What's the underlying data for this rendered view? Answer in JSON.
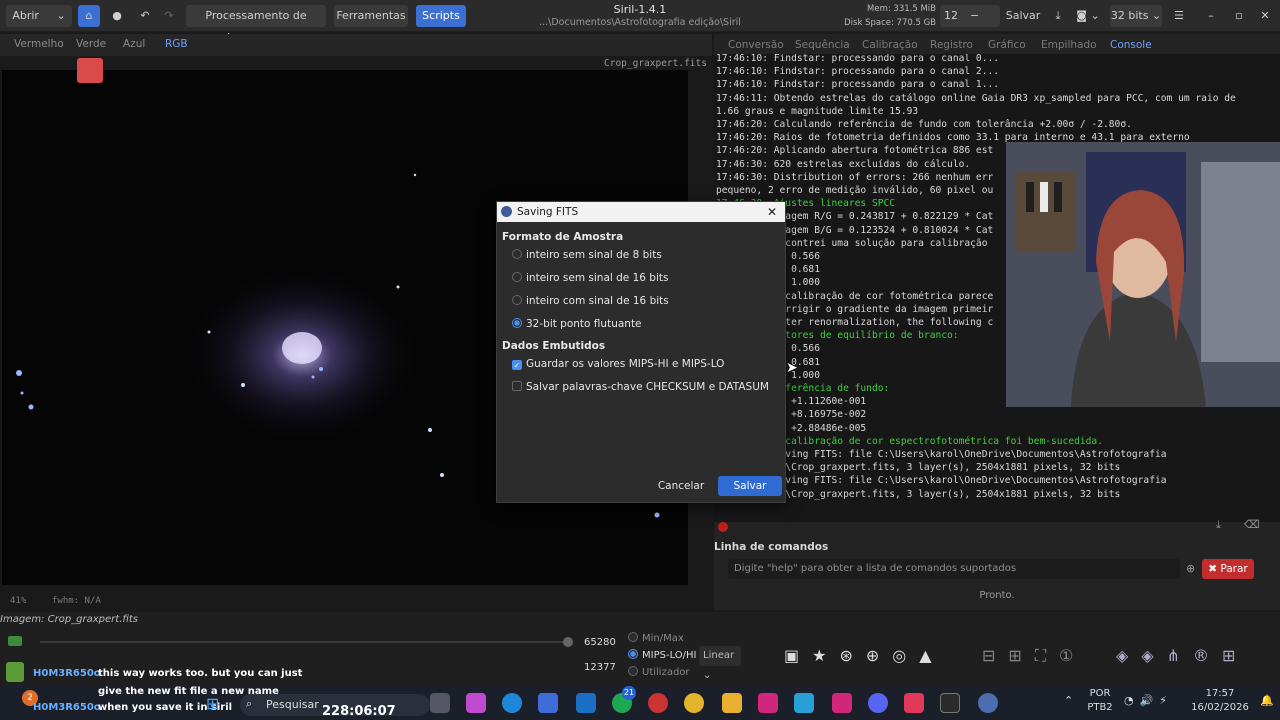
{
  "app": {
    "title": "Siril-1.4.1",
    "path": "...\\Documentos\\Astrofotografia edição\\Siril",
    "mem": "Mem: 331.5 MiB",
    "disk": "Disk Space: 770.5 GB",
    "threads": "12",
    "bitdepth": "32 bits",
    "open_label": "Abrir",
    "img_proc_label": "Processamento de imagem",
    "tools_label": "Ferramentas",
    "scripts_label": "Scripts",
    "save_label": "Salvar"
  },
  "channel_tabs": [
    "Vermelho",
    "Verde",
    "Azul",
    "RGB"
  ],
  "image_filename": "Crop_graxpert.fits",
  "canvas_status": {
    "zoom": "41%",
    "fwhm": "fwhm: N/A"
  },
  "right_tabs": [
    "Conversão",
    "Sequência",
    "Calibração",
    "Registro",
    "Gráfico",
    "Empilhado",
    "Console"
  ],
  "console_lines": [
    "17:46:10: Findstar: processando para o canal 0...",
    "17:46:10: Findstar: processando para o canal 2...",
    "17:46:10: Findstar: processando para o canal 1...",
    "17:46:11: Obtendo estrelas do catálogo online Gaia DR3 xp_sampled para PCC, com um raio de",
    "1.66 graus e magnitude limite 15.93",
    "17:46:20: Calculando referência de fundo com tolerância +2.00σ / -2.80σ.",
    "17:46:20: Raios de fotometria definidos como 33.1 para interno e 43.1 para externo",
    "17:46:20: Aplicando abertura fotométrica 886 est",
    "17:46:30: 620 estrelas excluídas do cálculo.",
    "17:46:30: Distribution of errors: 266 nenhum err",
    "pequeno, 2 erro de medição inválido, 60 pixel ou",
    "17:46:30: Ajustes lineares SPCC",
    "17:46:30: Imagem R/G = 0.243817 + 0.822129 * Cat",
    "17:46:30: Imagem B/G = 0.123524 + 0.810024 * Cat",
    "17:46:30: Encontrei uma solução para calibração",
    "17:46:30: R: 0.566",
    "17:46:30: G: 0.681",
    "17:46:30: B: 1.000",
    "17:46:30: A calibração de cor fotométrica parece",
    "17:46:30: corrigir o gradiente da imagem primeir",
    "17:46:30: After renormalization, the following c",
    "17:46:30: Fatores de equilíbrio de branco:",
    "17:46:30: R: 0.566",
    "17:46:30: G: 0.681",
    "17:46:30: B: 1.000",
    "17:46:30: Referência de fundo:",
    "17:46:30: R: +1.11260e-001",
    "17:46:30: G: +8.16975e-002",
    "17:46:30: B: +2.88486e-005",
    "17:46:30: A calibração de cor espectrofotométrica foi bem-sucedida.",
    "17:46:51: Saving FITS: file C:\\Users\\karol\\OneDrive\\Documentos\\Astrofotografia",
    "edição\\Siril\\Crop_graxpert.fits, 3 layer(s), 2504x1881 pixels, 32 bits",
    "17:57:12: Saving FITS: file C:\\Users\\karol\\OneDrive\\Documentos\\Astrofotografia",
    "edição\\Siril\\Crop_graxpert.fits, 3 layer(s), 2504x1881 pixels, 32 bits"
  ],
  "command": {
    "label": "Linha de comandos",
    "placeholder": "Digite \"help\" para obter a lista de comandos suportados",
    "stop": "Parar",
    "status": "Pronto."
  },
  "bottom": {
    "image_label": "Imagem: Crop_graxpert.fits",
    "max_value": "65280",
    "min_value": "12377",
    "minmax": "Min/Max",
    "mips": "MIPS-LO/HI",
    "user": "Utilizador",
    "scale": "Linear"
  },
  "dialog": {
    "title": "Saving FITS",
    "section_format": "Formato de Amostra",
    "format_options": [
      {
        "label": "inteiro sem sinal de 8 bits",
        "selected": false
      },
      {
        "label": "inteiro sem sinal de 16 bits",
        "selected": false
      },
      {
        "label": "inteiro com sinal de 16 bits",
        "selected": false
      },
      {
        "label": "32-bit ponto flutuante",
        "selected": true
      }
    ],
    "section_embedded": "Dados Embutidos",
    "checks": [
      {
        "label": "Guardar os valores MIPS-HI e MIPS-LO",
        "checked": true
      },
      {
        "label": "Salvar palavras-chave CHECKSUM e DATASUM",
        "checked": false
      }
    ],
    "cancel": "Cancelar",
    "save": "Salvar"
  },
  "chat": {
    "user": "H0M3R650o",
    "line1": "this way works too. but you can just",
    "line2": "give the new fit file a new name",
    "line3": "when you save it in siril",
    "badge": "2",
    "timer": "228:06:07"
  },
  "taskbar": {
    "search": "Pesquisar",
    "lang": "POR",
    "layout": "PTB2",
    "time": "17:57",
    "date": "16/02/2026",
    "teams_badge": "21"
  }
}
